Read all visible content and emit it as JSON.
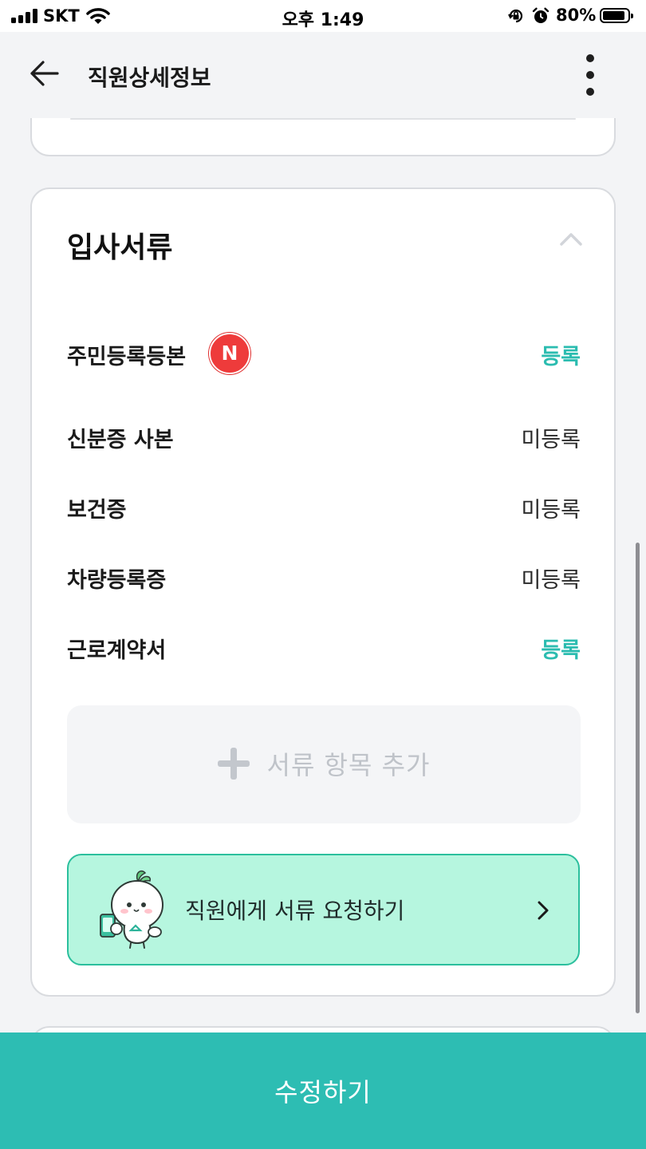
{
  "status_bar": {
    "carrier": "SKT",
    "time": "오후 1:49",
    "battery_percent": "80%",
    "battery_level": 0.8
  },
  "header": {
    "title": "직원상세정보",
    "back_icon": "arrow-left-icon",
    "more_icon": "more-vertical-icon"
  },
  "documents_section": {
    "title": "입사서류",
    "collapse_icon": "chevron-up-icon",
    "items": [
      {
        "name": "주민등록등본",
        "status": "등록",
        "registered": true,
        "badge": "N"
      },
      {
        "name": "신분증 사본",
        "status": "미등록",
        "registered": false
      },
      {
        "name": "보건증",
        "status": "미등록",
        "registered": false
      },
      {
        "name": "차량등록증",
        "status": "미등록",
        "registered": false
      },
      {
        "name": "근로계약서",
        "status": "등록",
        "registered": true
      }
    ],
    "add_button_label": "서류 항목 추가",
    "request_banner_label": "직원에게 서류 요청하기"
  },
  "bottom_button": {
    "label": "수정하기"
  },
  "colors": {
    "accent": "#2dbdb3",
    "registered_text": "#2bbcb0",
    "badge_red": "#ee3b3b",
    "banner_bg": "#b6f6df",
    "banner_border": "#2bbf9d",
    "background": "#f3f4f6"
  }
}
